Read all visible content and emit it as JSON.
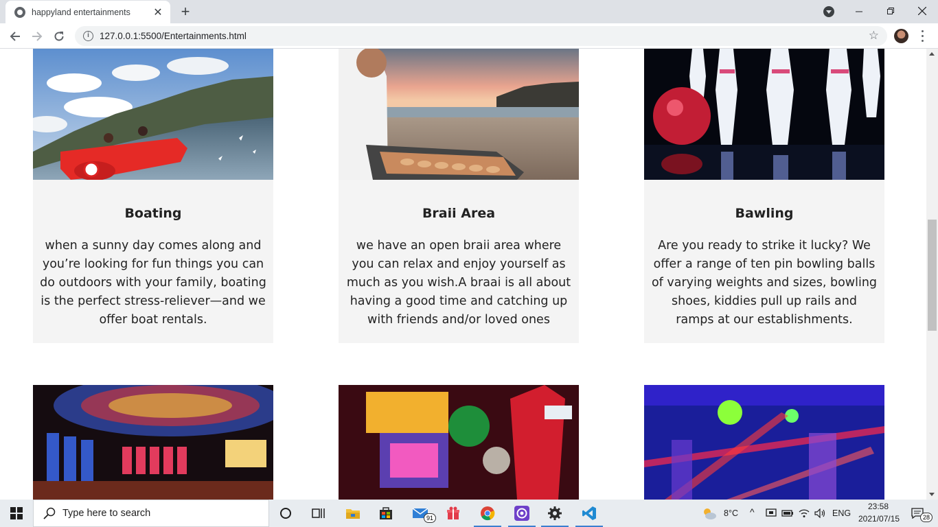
{
  "browser": {
    "tab_title": "happyland entertainments",
    "url": "127.0.0.1:5500/Entertainments.html",
    "new_tab_label": "+",
    "close_tab_label": "✕"
  },
  "cards": [
    {
      "title": "Boating",
      "text": "when a sunny day comes along and you’re looking for fun things you can do outdoors with your family, boating is the perfect stress-reliever—and we offer boat rentals.",
      "image_icon": "boating-photo"
    },
    {
      "title": "Braii Area",
      "text": "we have an open braii area where you can relax and enjoy yourself as much as you wish.A braai is all about having a good time and catching up with friends and/or loved ones",
      "image_icon": "braai-photo"
    },
    {
      "title": "Bawling",
      "text": "Are you ready to strike it lucky? We offer a range of ten pin bowling balls of varying weights and sizes, bowling shoes, kiddies pull up rails and ramps at our establishments.",
      "image_icon": "bowling-photo"
    }
  ],
  "second_row_images": [
    "casino-photo",
    "arcade-photo",
    "laser-tag-photo"
  ],
  "taskbar": {
    "search_placeholder": "Type here to search",
    "mail_badge": "91",
    "weather": "8°C",
    "language": "ENG",
    "time": "23:58",
    "date": "2021/07/15",
    "notification_count": "28"
  }
}
